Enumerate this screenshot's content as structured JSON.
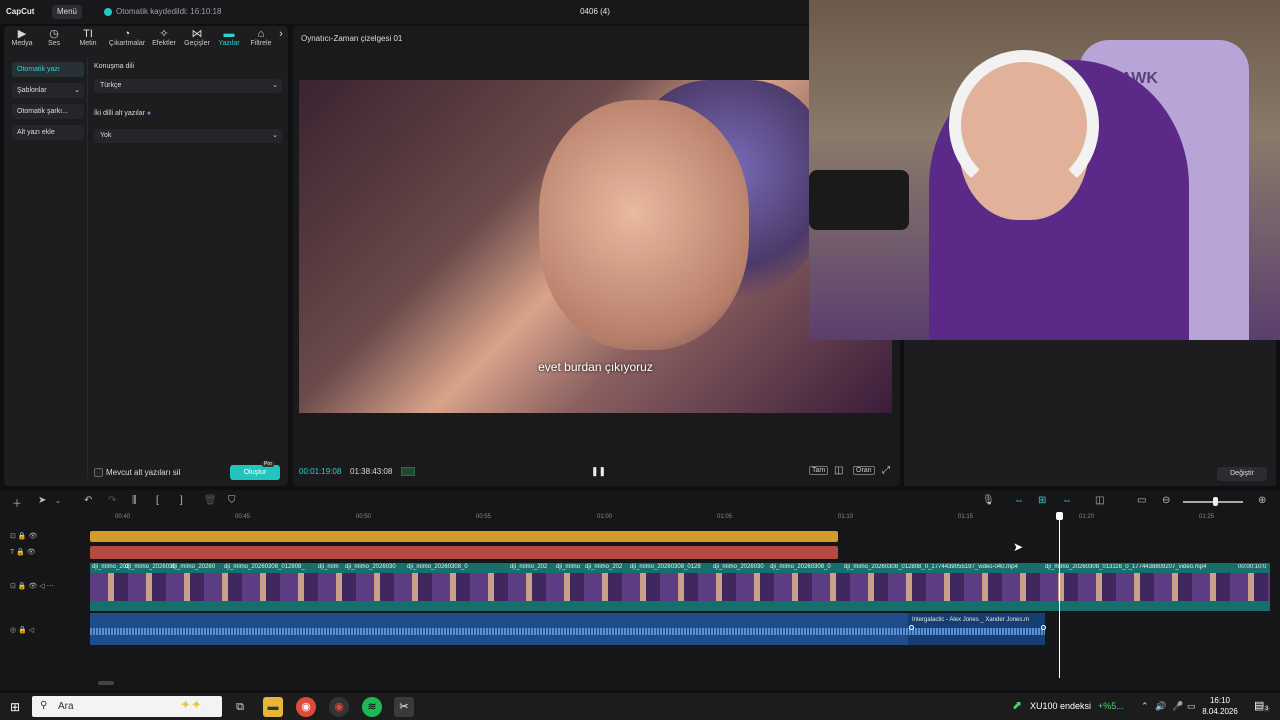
{
  "titlebar": {
    "logo": "CapCut",
    "menu_label": "Menü",
    "autosave": "Otomatik kaydedildi: 16:10:18",
    "project_title": "0406 (4)"
  },
  "toolbar": {
    "items": [
      {
        "label": "Medya",
        "icon": "media-icon"
      },
      {
        "label": "Ses",
        "icon": "audio-icon"
      },
      {
        "label": "Metin",
        "icon": "text-icon"
      },
      {
        "label": "Çıkartmalar",
        "icon": "sticker-icon"
      },
      {
        "label": "Efektler",
        "icon": "effects-icon"
      },
      {
        "label": "Geçişler",
        "icon": "transitions-icon"
      },
      {
        "label": "Yazılar",
        "icon": "captions-icon"
      },
      {
        "label": "Filtrele",
        "icon": "filter-icon"
      }
    ],
    "active": "Yazılar"
  },
  "sidebar": {
    "items": [
      {
        "label": "Otomatik yazı"
      },
      {
        "label": "Şablonlar"
      },
      {
        "label": "Otomatik şarkı..."
      },
      {
        "label": "Alt yazı ekle"
      }
    ]
  },
  "captions": {
    "speech_language_label": "Konuşma dili",
    "speech_language_value": "Türkçe",
    "bilingual_label": "İki dilli alt yazılar",
    "bilingual_value": "Yok",
    "delete_existing_label": "Mevcut alt yazıları sil",
    "generate_label": "Oluştur",
    "pro_badge": "Pro"
  },
  "player": {
    "title": "Oynatıcı-Zaman çizelgesi 01",
    "subtitle_text": "evet burdan çıkıyoruz",
    "current_time": "00:01:19:08",
    "total_time": "01:38:43:08",
    "btn_full": "Tam",
    "btn_ratio": "Oran"
  },
  "webcam": {
    "chair_brand": "HAWK"
  },
  "rightpanel": {
    "change_label": "Değiştir"
  },
  "timeline": {
    "ruler": [
      "00:40",
      "00:45",
      "00:50",
      "00:55",
      "01:00",
      "01:05",
      "01:10",
      "01:15",
      "01:20",
      "01:25"
    ],
    "clip_labels": [
      "dji_mimo_202",
      "dji_mimo_2026030",
      "dji_mimo_20260",
      "dji_mimo_20260308_012808_",
      "dji_mim",
      "dji_mimo_2026030",
      "dji_mimo_20260308_0",
      "dji_mimo_202",
      "dji_mimo",
      "dji_mimo_202",
      "dji_mimo_20260308_0128",
      "dji_mimo_2026030",
      "dji_mimo_20260308_0",
      "dji_mimo_20260308_012808_0_17744390551​97_video-040.mp4",
      "dji_mimo_20260308_013116_0_17744388​09207_video.mp4",
      "00:00:10:0"
    ],
    "audio_label": "Intergalactic - Alex Jones _ Xander Jones.m"
  },
  "taskbar": {
    "search_placeholder": "Ara",
    "stock_name": "XU100 endeksi",
    "stock_change": "+%5...",
    "time": "16:10",
    "date": "8.04.2026",
    "notif_count": "3"
  }
}
